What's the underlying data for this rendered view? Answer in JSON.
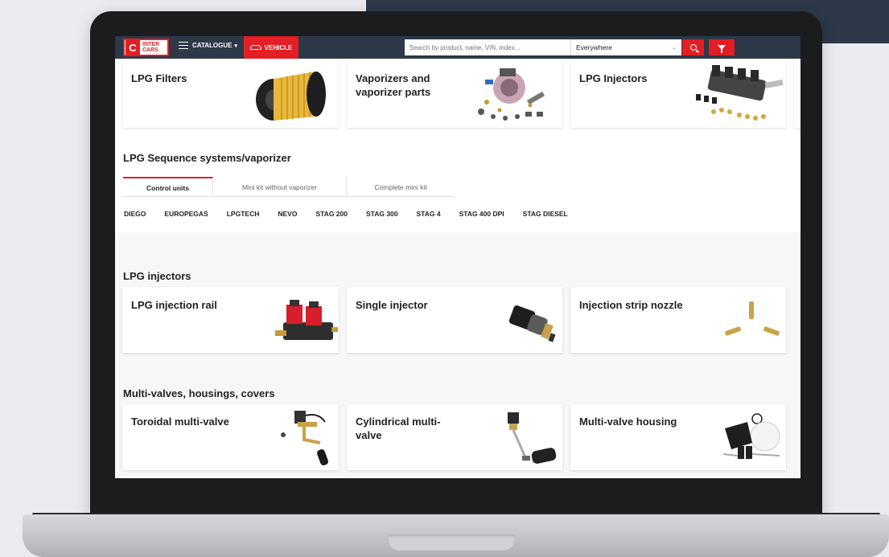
{
  "topbar": {
    "logo_line1": "INTER",
    "logo_line2": "CARS",
    "catalogue_label": "CATALOGUE",
    "vehicle_label": "VEHICLE",
    "search_placeholder": "Search by product, name, VIN, index...",
    "search_scope": "Everywhere"
  },
  "top_cards": [
    {
      "title": "LPG Filters"
    },
    {
      "title": "Vaporizers and vaporizer parts"
    },
    {
      "title": "LPG Injectors"
    }
  ],
  "sequence_section": {
    "title": "LPG Sequence systems/vaporizer",
    "tabs": [
      {
        "label": "Control units",
        "active": true
      },
      {
        "label": "Mini kit without vaporizer",
        "active": false
      },
      {
        "label": "Complete mini kit",
        "active": false
      }
    ],
    "brands": [
      "DIEGO",
      "EUROPEGAS",
      "LPGTECH",
      "NEVO",
      "STAG 200",
      "STAG 300",
      "STAG 4",
      "STAG 400 DPI",
      "STAG DIESEL"
    ]
  },
  "injectors_section": {
    "title": "LPG injectors",
    "cards": [
      {
        "title": "LPG injection rail"
      },
      {
        "title": "Single injector"
      },
      {
        "title": "Injection strip nozzle"
      }
    ]
  },
  "multivalve_section": {
    "title": "Multi-valves, housings, covers",
    "cards": [
      {
        "title": "Toroidal multi-valve"
      },
      {
        "title": "Cylindrical multi-valve"
      },
      {
        "title": "Multi-valve housing"
      }
    ]
  },
  "colors": {
    "brand_red": "#e31e24",
    "topbar": "#2d3848"
  }
}
